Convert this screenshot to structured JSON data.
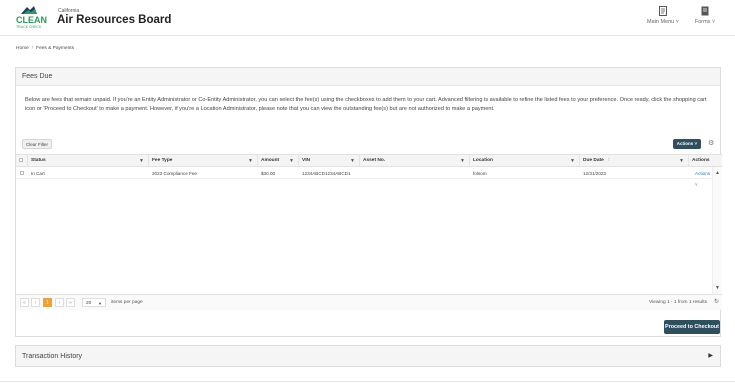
{
  "header": {
    "logo_text": "CLEAN",
    "logo_subtext": "TRUCK CHECK",
    "org_small": "California",
    "org_title": "Air Resources Board",
    "nav": [
      {
        "label": "Main Menu ˅",
        "icon": "document-icon"
      },
      {
        "label": "Forms ˅",
        "icon": "forms-icon"
      }
    ]
  },
  "breadcrumb": {
    "home": "Home",
    "separator": "/",
    "current": "Fees & Payments"
  },
  "fees_due": {
    "title": "Fees Due",
    "description": "Below are fees that remain unpaid. If you're an Entity Administrator or Co-Entity Administrator, you can select the fee(s) using the checkboxes to add them to your cart. Advanced filtering is available to refine the listed fees to your preference. Once ready, click the shopping cart icon or 'Proceed to Checkout' to make a payment. However, if you're a Location Administrator, please note that you can view the outstanding fee(s) but are not authorized to make a payment.",
    "clear_filter": "Clear Filter",
    "actions_label": "Actions ˅",
    "columns": [
      "Status",
      "Fee Type",
      "Amount",
      "VIN",
      "Asset No.",
      "Location",
      "Due Date",
      "Actions"
    ],
    "rows": [
      {
        "status": "In Cart",
        "fee_type": "2023 Compliance Fee",
        "amount": "$30.00",
        "vin": "1234ABCD1234ABCD1",
        "asset_no": "",
        "location": "folsom",
        "due_date": "12/31/2023",
        "actions": "Actions ˅"
      }
    ],
    "pager": {
      "pages": [
        "«",
        "‹",
        "1",
        "›",
        "»"
      ],
      "current_page": "1",
      "page_size": "20",
      "per_page_label": "items per page",
      "viewing": "Viewing 1 - 1 from 1 results"
    },
    "checkout_label": "Proceed to Checkout"
  },
  "transaction_history": {
    "title": "Transaction History"
  },
  "colors": {
    "primary_button": "#2f4f5f",
    "accent_page": "#f0a13a",
    "link": "#2f78c4",
    "brand_green": "#2e9a5c",
    "brand_navy": "#1e3a6b"
  }
}
